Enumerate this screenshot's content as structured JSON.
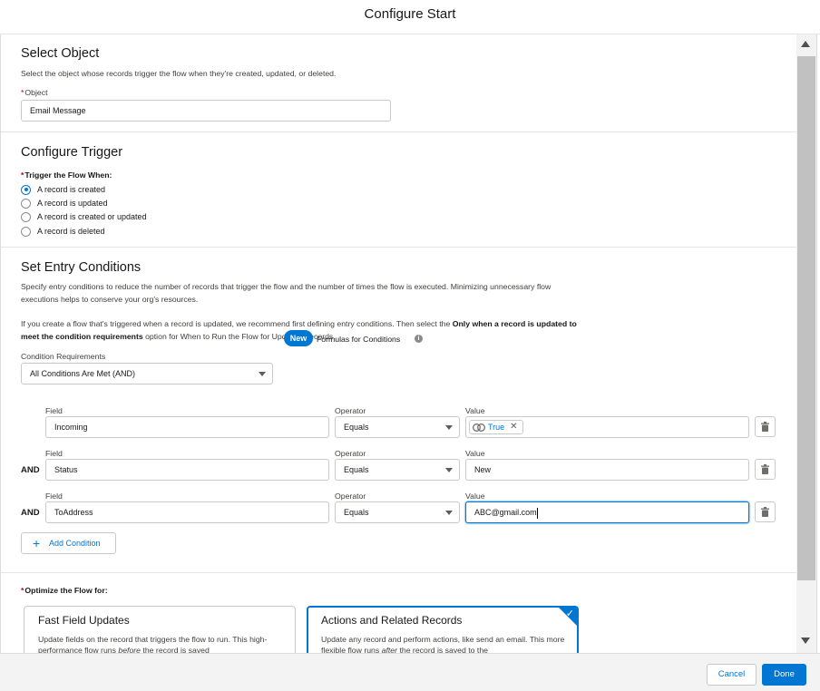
{
  "modal": {
    "title": "Configure Start"
  },
  "select_object": {
    "title": "Select Object",
    "description": "Select the object whose records trigger the flow when they're created, updated, or deleted.",
    "field_label": "Object",
    "required_mark": "*",
    "value": "Email Message"
  },
  "configure_trigger": {
    "title": "Configure Trigger",
    "label": "Trigger the Flow When:",
    "required_mark": "*",
    "options": [
      {
        "label": "A record is created",
        "selected": true
      },
      {
        "label": "A record is updated",
        "selected": false
      },
      {
        "label": "A record is created or updated",
        "selected": false
      },
      {
        "label": "A record is deleted",
        "selected": false
      }
    ]
  },
  "entry_conditions": {
    "title": "Set Entry Conditions",
    "desc1": "Specify entry conditions to reduce the number of records that trigger the flow and the number of times the flow is executed. Minimizing unnecessary flow executions helps to conserve your org's resources.",
    "desc2_a": "If you create a flow that's triggered when a record is updated, we recommend first defining entry conditions. Then select the ",
    "desc2_b": "Only when a record is updated to meet the condition requirements",
    "desc2_c": " option for When to Run the Flow for Updated Records.",
    "requirements_label": "Condition Requirements",
    "requirements_value": "All Conditions Are Met (AND)",
    "new_badge": "New",
    "formulas_label": "Formulas for Conditions",
    "field_label": "Field",
    "operator_label": "Operator",
    "value_label": "Value",
    "and_label": "AND",
    "conditions": [
      {
        "field": "Incoming",
        "operator": "Equals",
        "value": "True"
      },
      {
        "field": "Status",
        "operator": "Equals",
        "value": "New"
      },
      {
        "field": "ToAddress",
        "operator": "Equals",
        "value": "ABC@gmail.com"
      }
    ],
    "add_condition": "Add Condition"
  },
  "optimize": {
    "label": "Optimize the Flow for:",
    "required_mark": "*",
    "cards": [
      {
        "title": "Fast Field Updates",
        "desc_a": "Update fields on the record that triggers the flow to run. This high-performance flow runs ",
        "desc_em": "before",
        "desc_b": " the record is saved",
        "selected": false
      },
      {
        "title": "Actions and Related Records",
        "desc_a": "Update any record and perform actions, like send an email. This more flexible flow runs ",
        "desc_em": "after",
        "desc_b": " the record is saved to the",
        "selected": true
      }
    ]
  },
  "footer": {
    "cancel": "Cancel",
    "done": "Done"
  },
  "colors": {
    "brand": "#0176d3",
    "required": "#ba0517",
    "border": "#c9c9c9"
  }
}
